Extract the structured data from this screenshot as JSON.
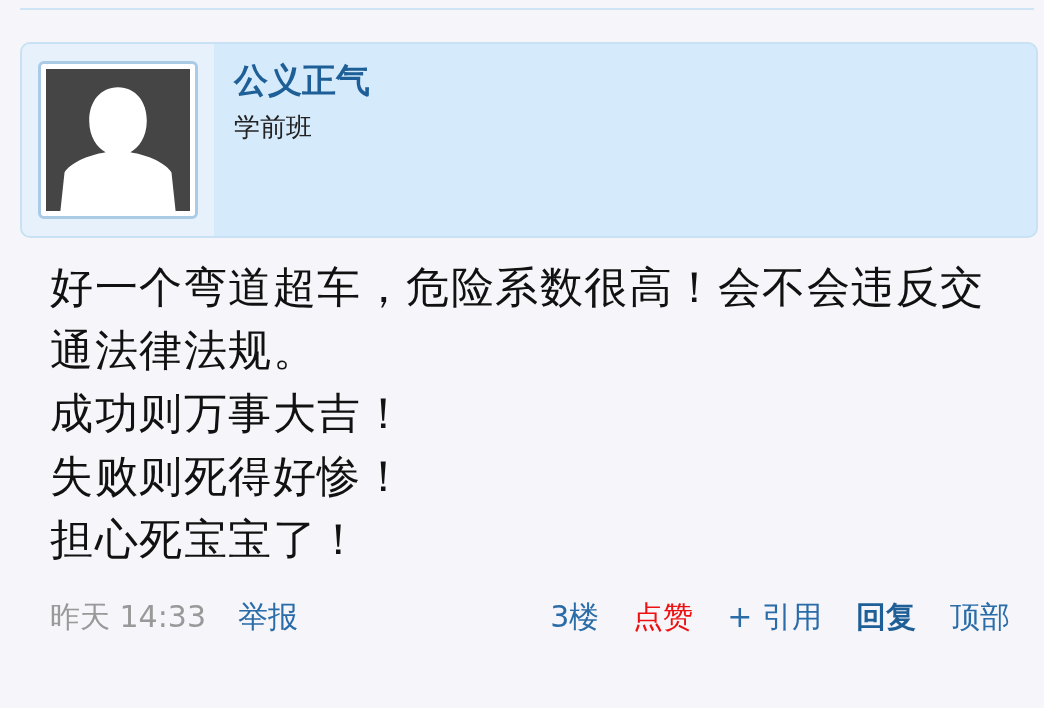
{
  "post": {
    "author": "公义正气",
    "rank": "学前班",
    "body": [
      "好一个弯道超车，危险系数很高！会不会违反交通法律法规。",
      "成功则万事大吉！",
      "失败则死得好惨！",
      "担心死宝宝了！"
    ],
    "time": "昨天 14:33",
    "report": "举报",
    "actions": [
      {
        "kind": "floor",
        "label": "3楼"
      },
      {
        "kind": "like",
        "label": "点赞"
      },
      {
        "kind": "quote",
        "label": "+ 引用"
      },
      {
        "kind": "reply",
        "label": "回复"
      },
      {
        "kind": "top",
        "label": "顶部"
      }
    ]
  }
}
